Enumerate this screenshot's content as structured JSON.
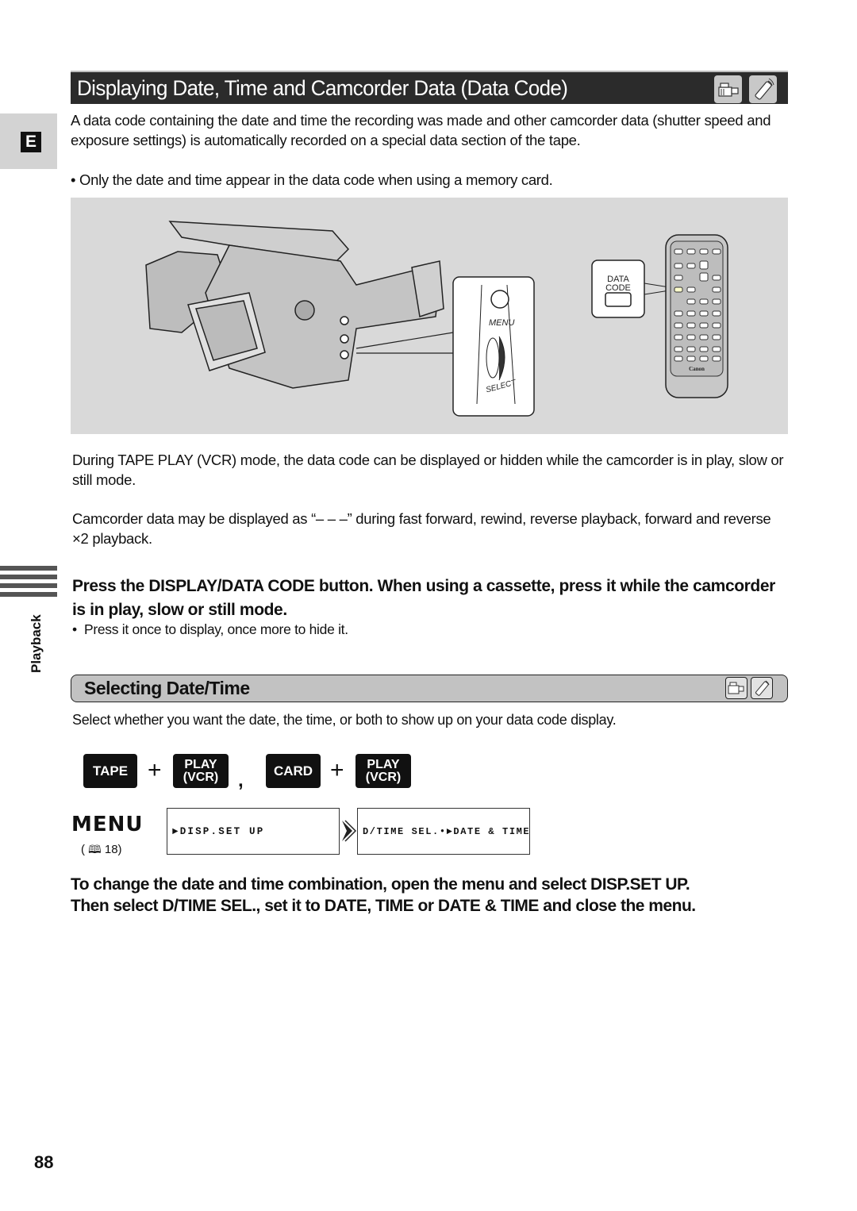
{
  "section_tab": "E",
  "header": {
    "title": "Displaying Date, Time and Camcorder Data (Data Code)",
    "icons": [
      "camcorder-icon",
      "remote-control-icon"
    ]
  },
  "intro": {
    "paragraph": "A data code containing the date and time the recording was made and other camcorder data (shutter speed and exposure settings) is automatically recorded on a special data section of the tape.",
    "bullet": "Only the date and time appear in the data code when using a memory card."
  },
  "illustration": {
    "camcorder_labels": {
      "menu": "MENU",
      "select": "SELECT"
    },
    "remote_labels": {
      "data_code_line1": "DATA",
      "data_code_line2": "CODE",
      "brand": "Canon"
    }
  },
  "body": {
    "paragraph1": "During TAPE PLAY (VCR) mode, the data code can be displayed or hidden while the camcorder is in play, slow or still mode.",
    "paragraph2": "Camcorder data may be displayed as “– – –” during fast forward, rewind, reverse playback, forward and reverse ×2 playback."
  },
  "side": {
    "chapter": "Playback"
  },
  "step": {
    "instruction": "Press the DISPLAY/DATA CODE button. When using a cassette, press it while the camcorder is in play, slow or still mode.",
    "bullet": "Press it once to display, once more to hide it."
  },
  "subsection": {
    "title": "Selecting Date/Time",
    "icons": [
      "camcorder-icon",
      "remote-control-icon"
    ],
    "description": "Select whether you want the date, the time, or both to show up on your data code display."
  },
  "modes": {
    "tape": "TAPE",
    "plus": "+",
    "play_line1": "PLAY",
    "play_line2": "(VCR)",
    "separator": ",",
    "card": "CARD"
  },
  "menu": {
    "label": "MENU",
    "reference": "( 🕮 18)",
    "reference_page": "18",
    "step1": "►DISP.SET UP",
    "step2": "D/TIME SEL.•►DATE & TIME"
  },
  "closing": {
    "line1": "To change the date and time combination, open the menu and select DISP.SET UP.",
    "line2": "Then select D/TIME SEL., set it to DATE, TIME or DATE & TIME and close the menu."
  },
  "page_number": "88"
}
